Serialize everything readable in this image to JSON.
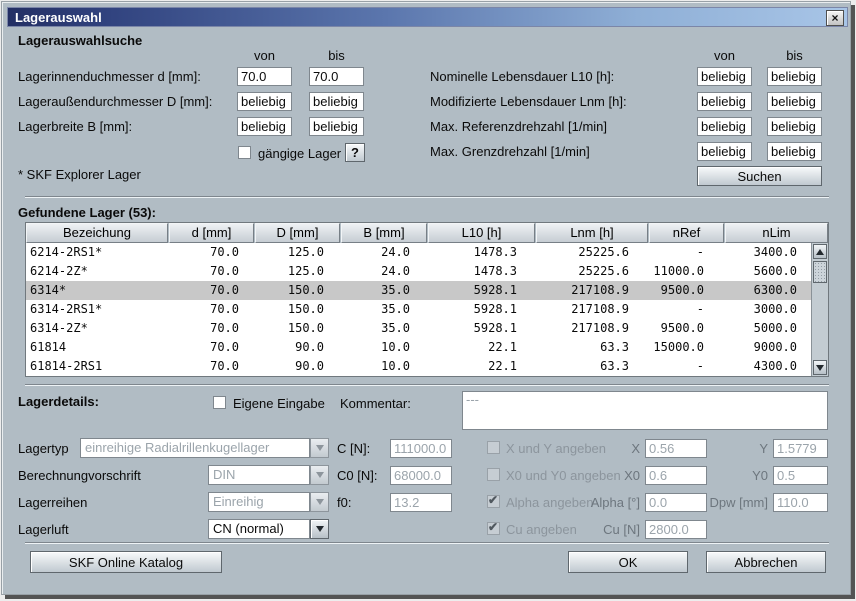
{
  "window": {
    "title": "Lagerauswahl"
  },
  "icons": {
    "close": "×",
    "check": "✔"
  },
  "search": {
    "heading": "Lagerauswahlsuche",
    "col_von": "von",
    "col_bis": "bis",
    "left_rows": [
      {
        "label": "Lagerinnenduchmesser d [mm]:",
        "von": "70.0",
        "bis": "70.0"
      },
      {
        "label": "Lageraußendurchmesser D [mm]:",
        "von": "beliebig",
        "bis": "beliebig"
      },
      {
        "label": "Lagerbreite B [mm]:",
        "von": "beliebig",
        "bis": "beliebig"
      }
    ],
    "right_rows": [
      {
        "label": "Nominelle Lebensdauer L10 [h]:",
        "von": "beliebig",
        "bis": "beliebig"
      },
      {
        "label": "Modifizierte Lebensdauer Lnm [h]:",
        "von": "beliebig",
        "bis": "beliebig"
      },
      {
        "label": "Max. Referenzdrehzahl [1/min]",
        "von": "beliebig",
        "bis": "beliebig"
      },
      {
        "label": "Max. Grenzdrehzahl [1/min]",
        "von": "beliebig",
        "bis": "beliebig"
      }
    ],
    "common_checkbox": "gängige Lager",
    "help_label": "?",
    "explorer_note": "* SKF Explorer Lager",
    "search_button": "Suchen"
  },
  "results": {
    "heading": "Gefundene Lager (53):",
    "columns": [
      "Bezeichung",
      "d [mm]",
      "D [mm]",
      "B [mm]",
      "L10 [h]",
      "Lnm [h]",
      "nRef",
      "nLim"
    ],
    "rows": [
      [
        "6214-2RS1*",
        "70.0",
        "125.0",
        "24.0",
        "1478.3",
        "25225.6",
        "-",
        "3400.0"
      ],
      [
        "6214-2Z*",
        "70.0",
        "125.0",
        "24.0",
        "1478.3",
        "25225.6",
        "11000.0",
        "5600.0"
      ],
      [
        "6314*",
        "70.0",
        "150.0",
        "35.0",
        "5928.1",
        "217108.9",
        "9500.0",
        "6300.0"
      ],
      [
        "6314-2RS1*",
        "70.0",
        "150.0",
        "35.0",
        "5928.1",
        "217108.9",
        "-",
        "3000.0"
      ],
      [
        "6314-2Z*",
        "70.0",
        "150.0",
        "35.0",
        "5928.1",
        "217108.9",
        "9500.0",
        "5000.0"
      ],
      [
        "61814",
        "70.0",
        "90.0",
        "10.0",
        "22.1",
        "63.3",
        "15000.0",
        "9000.0"
      ],
      [
        "61814-2RS1",
        "70.0",
        "90.0",
        "10.0",
        "22.1",
        "63.3",
        "-",
        "4300.0"
      ]
    ],
    "selected_row_label": "6314*"
  },
  "details": {
    "heading": "Lagerdetails:",
    "own_input_checkbox": "Eigene Eingabe",
    "comment_label": "Kommentar:",
    "comment_value": "---",
    "type_label": "Lagertyp",
    "type_value": "einreihige Radialrillenkugellager",
    "calc_label": "Berechnungvorschrift",
    "calc_value": "DIN",
    "rows_label": "Lagerreihen",
    "rows_value": "Einreihig",
    "clearance_label": "Lagerluft",
    "clearance_value": "CN (normal)",
    "c_label": "C [N]:",
    "c_value": "111000.0",
    "c0_label": "C0 [N]:",
    "c0_value": "68000.0",
    "f0_label": "f0:",
    "f0_value": "13.2",
    "xy_checkbox": "X und Y angeben",
    "x_label": "X",
    "x_value": "0.56",
    "y_label": "Y",
    "y_value": "1.5779",
    "x0y0_checkbox": "X0 und Y0 angeben",
    "x0_label": "X0",
    "x0_value": "0.6",
    "y0_label": "Y0",
    "y0_value": "0.5",
    "alpha_checkbox": "Alpha angeben",
    "alpha_label": "Alpha [°]",
    "alpha_value": "0.0",
    "dpw_label": "Dpw [mm]",
    "dpw_value": "110.0",
    "cu_checkbox": "Cu angeben",
    "cu_label": "Cu [N]",
    "cu_value": "2800.0"
  },
  "footer": {
    "catalog_button": "SKF Online Katalog",
    "ok_button": "OK",
    "cancel_button": "Abbrechen"
  }
}
